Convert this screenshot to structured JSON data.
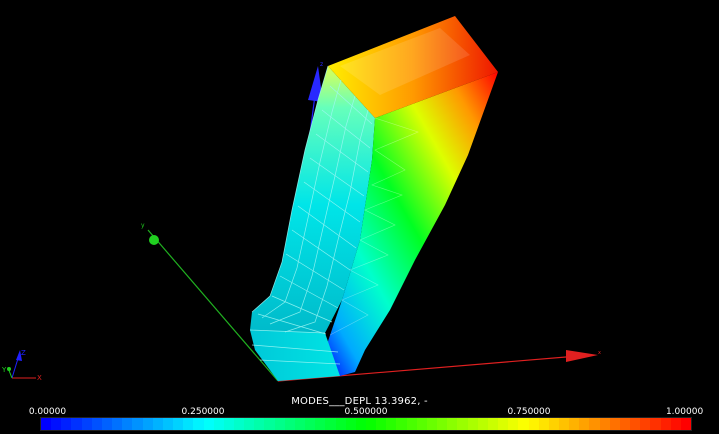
{
  "view": {
    "field_name": "MODES___DEPL 13.3962, -",
    "colormap": [
      "#0000ff",
      "#00ffff",
      "#00ff00",
      "#ffff00",
      "#ff0000"
    ],
    "background": "#000000"
  },
  "scalar_bar": {
    "ticks": [
      "0.00000",
      "0.250000",
      "0.500000",
      "0.750000",
      "1.00000"
    ],
    "range": [
      0,
      1
    ]
  },
  "axes_labels": {
    "x": "x",
    "y": "y",
    "z": "z"
  },
  "orientation_widget": {
    "x": "X",
    "y": "Y",
    "z": "Z"
  }
}
